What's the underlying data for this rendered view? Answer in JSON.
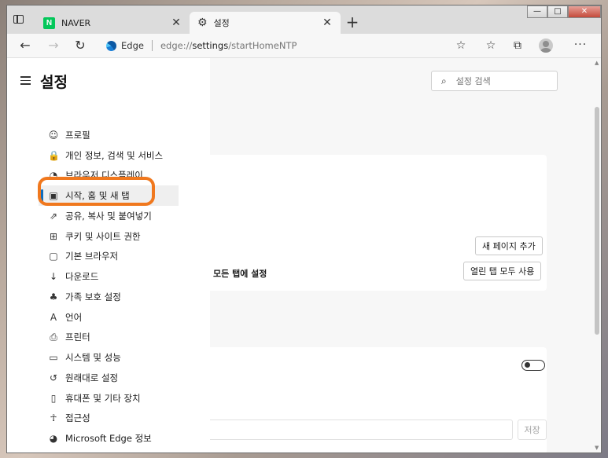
{
  "tabs": [
    {
      "title": "NAVER",
      "icon": "naver-icon",
      "icon_letter": "N",
      "active": false
    },
    {
      "title": "설정",
      "icon": "gear-icon",
      "active": true
    }
  ],
  "tab_close_glyph": "✕",
  "new_tab_glyph": "+",
  "window_controls": {
    "minimize": "—",
    "maximize": "□",
    "close": "✕"
  },
  "toolbar": {
    "back_glyph": "←",
    "forward_glyph": "→",
    "refresh_glyph": "↻",
    "site_label": "Edge",
    "url_scheme": "edge://",
    "url_host": "settings",
    "url_path": "/startHomeNTP",
    "favorite_add_glyph": "☆",
    "favorites_glyph": "☆",
    "collections_glyph": "⧉",
    "more_glyph": "···"
  },
  "settings": {
    "title": "설정",
    "search_placeholder": "설정 검색",
    "nav_items": [
      {
        "label": "프로필",
        "icon": "profile-icon",
        "glyph": "☺"
      },
      {
        "label": "개인 정보, 검색 및 서비스",
        "icon": "lock-icon",
        "glyph": "🔒"
      },
      {
        "label": "브라우저 디스플레이",
        "icon": "palette-icon",
        "glyph": "◔"
      },
      {
        "label": "시작, 홈 및 새 탭",
        "icon": "home-page-icon",
        "glyph": "▣",
        "selected": true
      },
      {
        "label": "공유, 복사 및 붙여넣기",
        "icon": "share-icon",
        "glyph": "⇗"
      },
      {
        "label": "쿠키 및 사이트 권한",
        "icon": "cookie-icon",
        "glyph": "⊞"
      },
      {
        "label": "기본 브라우저",
        "icon": "default-browser-icon",
        "glyph": "▢"
      },
      {
        "label": "다운로드",
        "icon": "download-icon",
        "glyph": "↓"
      },
      {
        "label": "가족 보호 설정",
        "icon": "family-icon",
        "glyph": "♣"
      },
      {
        "label": "언어",
        "icon": "language-icon",
        "glyph": "A"
      },
      {
        "label": "프린터",
        "icon": "printer-icon",
        "glyph": "⎙"
      },
      {
        "label": "시스템 및 성능",
        "icon": "system-icon",
        "glyph": "▭"
      },
      {
        "label": "원래대로 설정",
        "icon": "reset-icon",
        "glyph": "↺"
      },
      {
        "label": "휴대폰 및 기타 장치",
        "icon": "phone-icon",
        "glyph": "▯"
      },
      {
        "label": "접근성",
        "icon": "accessibility-icon",
        "glyph": "☥"
      },
      {
        "label": "Microsoft Edge 정보",
        "icon": "edge-icon",
        "glyph": "◕"
      }
    ]
  },
  "main": {
    "card1": {
      "add_page_button": "새 페이지 추가",
      "open_tabs_text": "모든 탭에 설정",
      "use_open_tabs_button": "열린 탭 모두 사용"
    },
    "card2": {
      "toggle_on": false,
      "save_button": "저장"
    }
  },
  "colors": {
    "highlight": "#f0781e",
    "accent": "#0f6cbd",
    "naver_green": "#03c75a"
  }
}
